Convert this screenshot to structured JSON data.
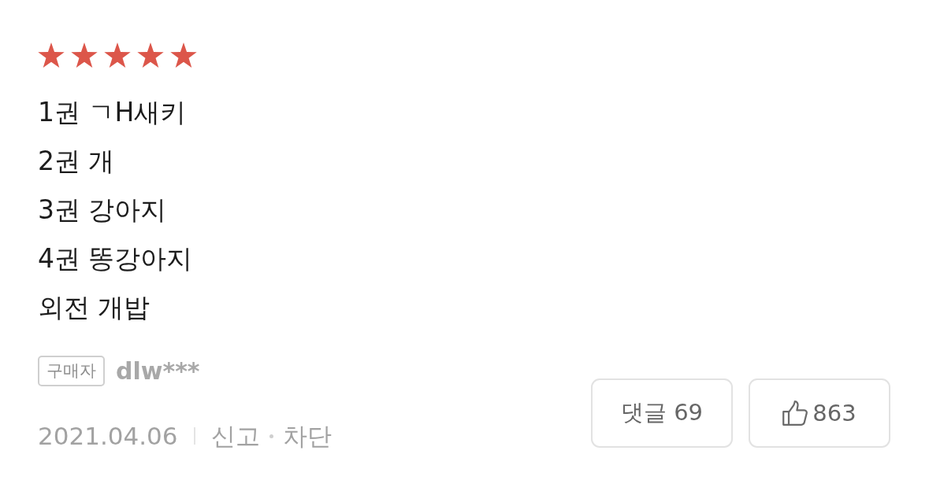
{
  "review": {
    "stars": 5,
    "lines": [
      "1권 ㄱH새키",
      "2권 개",
      "3권 강아지",
      "4권 똥강아지",
      "외전 개밥"
    ],
    "buyer_badge": "구매자",
    "username": "dlw***",
    "date": "2021.04.06",
    "actions": [
      {
        "label": "신고"
      },
      {
        "label": "차단"
      }
    ],
    "comment_button": {
      "label": "댓글",
      "count": "69"
    },
    "like_button": {
      "count": "863"
    }
  }
}
